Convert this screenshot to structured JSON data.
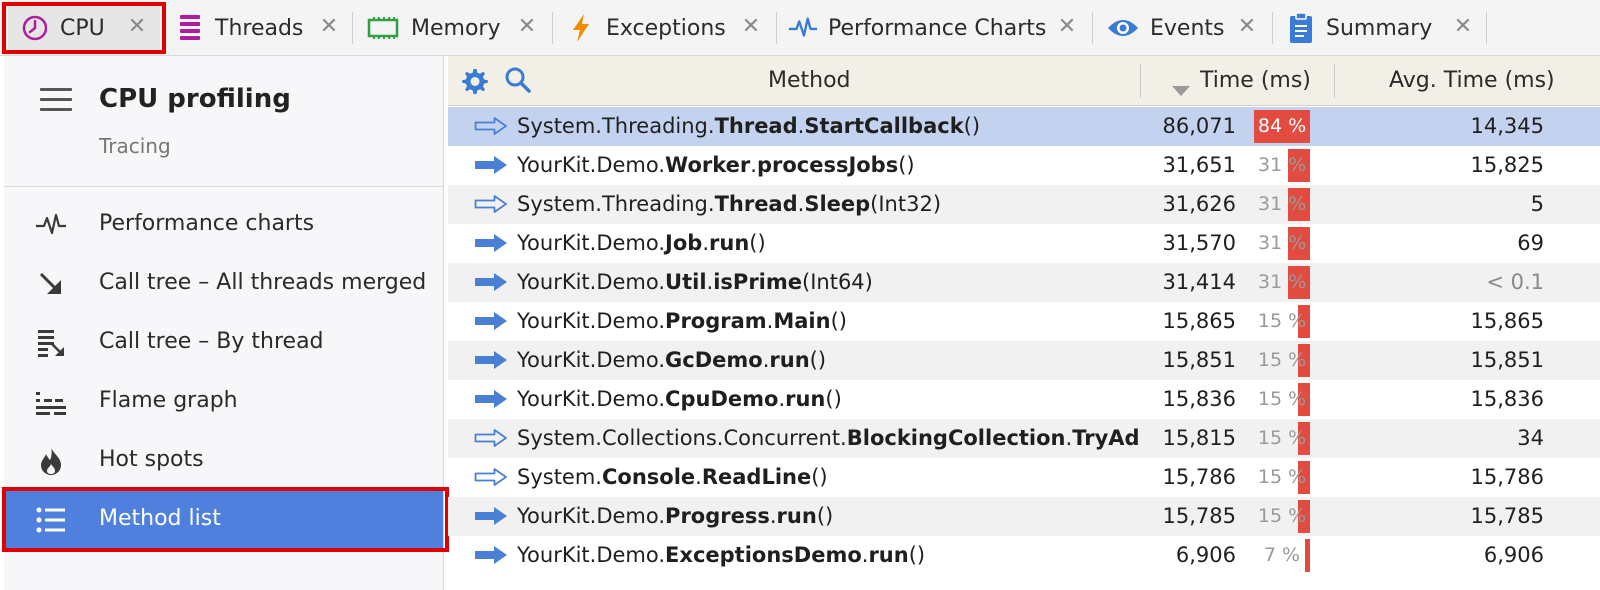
{
  "tabs": [
    {
      "label": "CPU",
      "icon": "cpu-clock-icon",
      "active": true
    },
    {
      "label": "Threads",
      "icon": "threads-icon"
    },
    {
      "label": "Memory",
      "icon": "memory-chip-icon"
    },
    {
      "label": "Exceptions",
      "icon": "lightning-icon"
    },
    {
      "label": "Performance Charts",
      "icon": "pulse-icon"
    },
    {
      "label": "Events",
      "icon": "eye-icon"
    },
    {
      "label": "Summary",
      "icon": "clipboard-icon"
    }
  ],
  "left_panel": {
    "title": "CPU profiling",
    "subtitle": "Tracing",
    "nav": [
      {
        "label": "Performance charts",
        "icon": "pulse-icon"
      },
      {
        "label": "Call tree – All threads merged",
        "icon": "arrow-down-right-icon"
      },
      {
        "label": "Call tree – By thread",
        "icon": "call-tree-thread-icon"
      },
      {
        "label": "Flame graph",
        "icon": "flame-graph-icon"
      },
      {
        "label": "Hot spots",
        "icon": "fire-icon"
      },
      {
        "label": "Method list",
        "icon": "list-icon",
        "selected": true
      }
    ]
  },
  "table": {
    "columns": {
      "method": "Method",
      "time": "Time (ms)",
      "avg": "Avg. Time (ms)"
    },
    "rows": [
      {
        "ns": "System.Threading.",
        "cls": "Thread",
        "meth": "StartCallback",
        "args": "()",
        "time": "86,071",
        "pct": 84,
        "pct_label": "84 %",
        "avg": "14,345",
        "arrow": "outline"
      },
      {
        "ns": "YourKit.Demo.",
        "cls": "Worker",
        "meth": "processJobs",
        "args": "()",
        "time": "31,651",
        "pct": 31,
        "pct_label": "31 %",
        "avg": "15,825",
        "arrow": "filled"
      },
      {
        "ns": "System.Threading.",
        "cls": "Thread",
        "meth": "Sleep",
        "args": "(Int32)",
        "time": "31,626",
        "pct": 31,
        "pct_label": "31 %",
        "avg": "5",
        "arrow": "outline"
      },
      {
        "ns": "YourKit.Demo.",
        "cls": "Job",
        "meth": "run",
        "args": "()",
        "time": "31,570",
        "pct": 31,
        "pct_label": "31 %",
        "avg": "69",
        "arrow": "filled"
      },
      {
        "ns": "YourKit.Demo.",
        "cls": "Util",
        "meth": "isPrime",
        "args": "(Int64)",
        "time": "31,414",
        "pct": 31,
        "pct_label": "31 %",
        "avg": "< 0.1",
        "arrow": "filled"
      },
      {
        "ns": "YourKit.Demo.",
        "cls": "Program",
        "meth": "Main",
        "args": "()",
        "time": "15,865",
        "pct": 15,
        "pct_label": "15 %",
        "avg": "15,865",
        "arrow": "filled"
      },
      {
        "ns": "YourKit.Demo.",
        "cls": "GcDemo",
        "meth": "run",
        "args": "()",
        "time": "15,851",
        "pct": 15,
        "pct_label": "15 %",
        "avg": "15,851",
        "arrow": "filled"
      },
      {
        "ns": "YourKit.Demo.",
        "cls": "CpuDemo",
        "meth": "run",
        "args": "()",
        "time": "15,836",
        "pct": 15,
        "pct_label": "15 %",
        "avg": "15,836",
        "arrow": "filled"
      },
      {
        "ns": "System.Collections.Concurrent.",
        "cls": "BlockingCollection",
        "meth": "TryAddWithNoTimeValidation",
        "args": "",
        "time": "15,815",
        "pct": 15,
        "pct_label": "15 %",
        "avg": "34",
        "arrow": "outline"
      },
      {
        "ns": "System.",
        "cls": "Console",
        "meth": "ReadLine",
        "args": "()",
        "time": "15,786",
        "pct": 15,
        "pct_label": "15 %",
        "avg": "15,786",
        "arrow": "outline"
      },
      {
        "ns": "YourKit.Demo.",
        "cls": "Progress",
        "meth": "run",
        "args": "()",
        "time": "15,785",
        "pct": 15,
        "pct_label": "15 %",
        "avg": "15,785",
        "arrow": "filled"
      },
      {
        "ns": "YourKit.Demo.",
        "cls": "ExceptionsDemo",
        "meth": "run",
        "args": "()",
        "time": "6,906",
        "pct": 7,
        "pct_label": "7 %",
        "avg": "6,906",
        "arrow": "filled"
      }
    ]
  },
  "colors": {
    "accent": "#4f80de",
    "bar": "#e24b3f",
    "arrow": "#4a80d4",
    "highlight": "#e00000"
  }
}
